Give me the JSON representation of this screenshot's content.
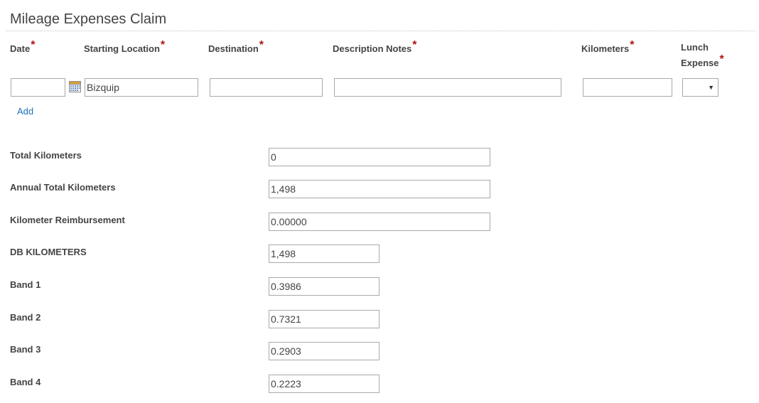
{
  "form": {
    "title": "Mileage Expenses Claim",
    "required_marker": "*"
  },
  "columns": {
    "date": "Date",
    "starting_location": "Starting Location",
    "destination": "Destination",
    "description_notes": "Description Notes",
    "kilometers": "Kilometers",
    "lunch_expense_line1": "Lunch",
    "lunch_expense_line2": "Expense"
  },
  "entry_row": {
    "date_value": "",
    "starting_location_value": "Bizquip",
    "destination_value": "",
    "description_value": "",
    "kilometers_value": "",
    "lunch_expense_selected": "",
    "calendar_icon": "calendar-icon",
    "dropdown_icon": "chevron-down-icon",
    "caret_glyph": "▼"
  },
  "actions": {
    "add_label": "Add"
  },
  "summary": {
    "total_kilometers": {
      "label": "Total Kilometers",
      "value": "0"
    },
    "annual_total_kilometers": {
      "label": "Annual Total Kilometers",
      "value": "1,498"
    },
    "kilometer_reimbursement": {
      "label": "Kilometer Reimbursement",
      "value": "0.00000"
    },
    "db_kilometers": {
      "label": "DB KILOMETERS",
      "value": "1,498"
    },
    "band_1": {
      "label": "Band 1",
      "value": "0.3986"
    },
    "band_2": {
      "label": "Band 2",
      "value": "0.7321"
    },
    "band_3": {
      "label": "Band 3",
      "value": "0.2903"
    },
    "band_4": {
      "label": "Band 4",
      "value": "0.2223"
    }
  },
  "colors": {
    "required": "#b01414",
    "link": "#1f6fb5",
    "input_border": "#a9a9a9",
    "label_text": "#444444"
  }
}
